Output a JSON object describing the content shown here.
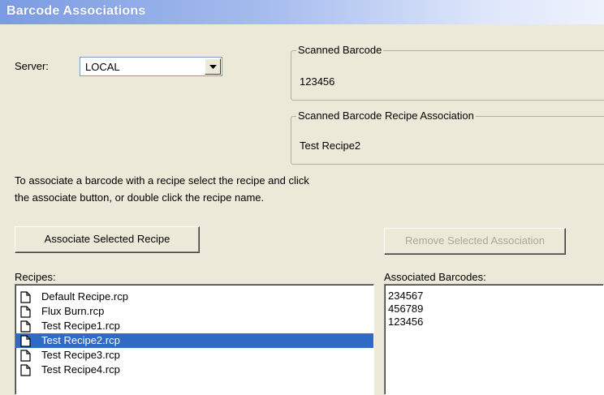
{
  "window": {
    "title": "Barcode Associations"
  },
  "server": {
    "label": "Server:",
    "value": "LOCAL"
  },
  "scanned_barcode": {
    "title": "Scanned Barcode",
    "value": "123456"
  },
  "scanned_association": {
    "title": "Scanned Barcode Recipe Association",
    "value": "Test Recipe2"
  },
  "instructions": {
    "line1": "To associate a barcode with a recipe select the recipe and click",
    "line2": "the associate button, or double click the recipe name."
  },
  "buttons": {
    "associate_label": "Associate Selected Recipe",
    "remove_label": "Remove Selected Association",
    "remove_enabled": false
  },
  "recipes": {
    "label": "Recipes:",
    "items": [
      {
        "name": "Default Recipe.rcp",
        "icon": "document-icon",
        "selected": false
      },
      {
        "name": "Flux Burn.rcp",
        "icon": "document-icon",
        "selected": false
      },
      {
        "name": "Test Recipe1.rcp",
        "icon": "document-icon",
        "selected": false
      },
      {
        "name": "Test Recipe2.rcp",
        "icon": "document-icon",
        "selected": true
      },
      {
        "name": "Test Recipe3.rcp",
        "icon": "document-icon",
        "selected": false
      },
      {
        "name": "Test Recipe4.rcp",
        "icon": "document-icon",
        "selected": false
      }
    ]
  },
  "associated": {
    "label": "Associated Barcodes:",
    "items": [
      "234567",
      "456789",
      "123456"
    ]
  },
  "colors": {
    "selection": "#316ac5",
    "window_bg": "#ece9d8",
    "disabled_text": "#aca899"
  }
}
